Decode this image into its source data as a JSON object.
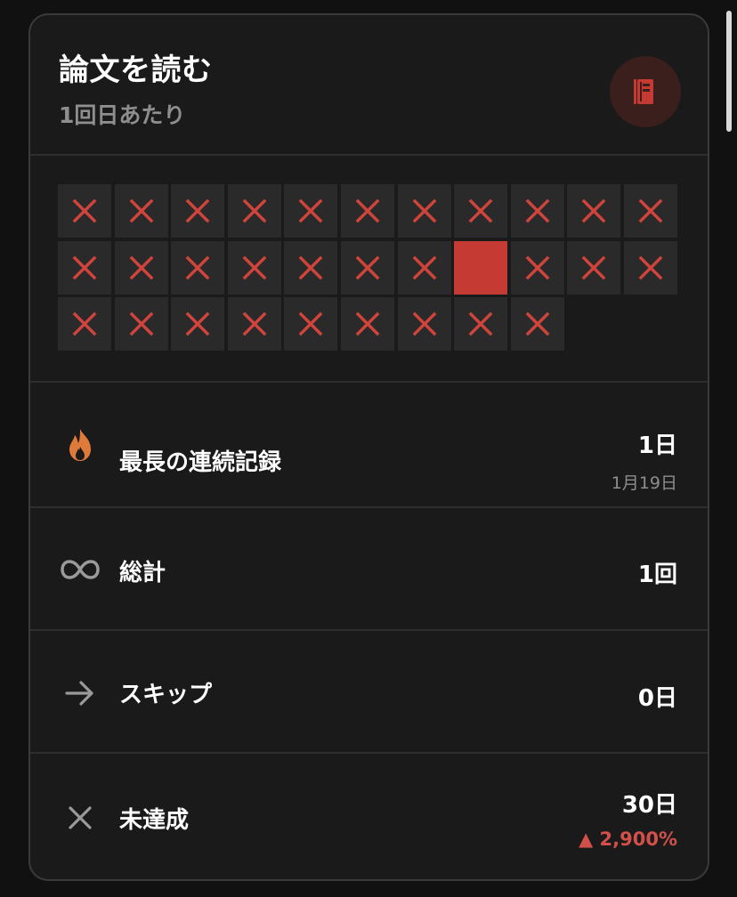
{
  "header": {
    "title": "論文を読む",
    "subtitle": "1回日あたり",
    "icon": "book-icon",
    "accent": "#c53a32"
  },
  "calendar": {
    "days": [
      "x",
      "x",
      "x",
      "x",
      "x",
      "x",
      "x",
      "x",
      "x",
      "x",
      "x",
      "x",
      "x",
      "x",
      "x",
      "x",
      "x",
      "x",
      "done",
      "x",
      "x",
      "x",
      "x",
      "x",
      "x",
      "x",
      "x",
      "x",
      "x",
      "x",
      "x"
    ]
  },
  "stats": {
    "streak": {
      "label": "最長の連続記録",
      "value": "1日",
      "sub": "1月19日",
      "icon": "flame-icon"
    },
    "total": {
      "label": "総計",
      "value": "1回",
      "icon": "infinity-icon"
    },
    "skip": {
      "label": "スキップ",
      "value": "0日",
      "icon": "arrow-right-icon"
    },
    "missed": {
      "label": "未達成",
      "value": "30日",
      "change": "2,900%",
      "icon": "x-icon"
    }
  }
}
